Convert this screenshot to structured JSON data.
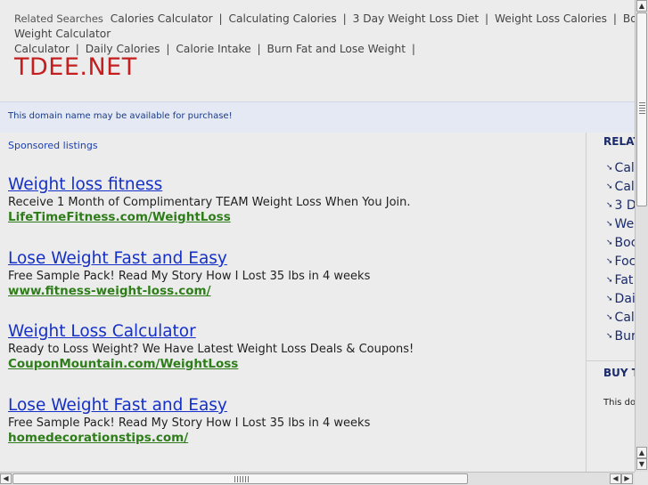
{
  "related_bar": {
    "label": "Related Searches",
    "links": [
      "Calories Calculator",
      "Calculating Calories",
      "3 Day Weight Loss Diet",
      "Weight Loss Calories",
      "Body Weight Calculator",
      "Calculator",
      "Daily Calories",
      "Calorie Intake",
      "Burn Fat and Lose Weight"
    ],
    "separator": "|"
  },
  "brand": {
    "name": "TDEE.NET",
    "color": "#c41e1e"
  },
  "notice": {
    "text": "This domain name may be available for purchase!"
  },
  "main": {
    "sponsored_label": "Sponsored listings",
    "ads": [
      {
        "title": "Weight loss fitness",
        "description": "Receive 1 Month of Complimentary TEAM Weight Loss When You Join.",
        "url": "LifeTimeFitness.com/WeightLoss"
      },
      {
        "title": "Lose Weight Fast and Easy",
        "description": "Free Sample Pack! Read My Story How I Lost 35 lbs in 4 weeks",
        "url": "www.fitness-weight-loss.com/"
      },
      {
        "title": "Weight Loss Calculator",
        "description": "Ready to Loss Weight? We Have Latest Weight Loss Deals & Coupons!",
        "url": "CouponMountain.com/WeightLoss"
      },
      {
        "title": "Lose Weight Fast and Easy",
        "description": "Free Sample Pack! Read My Story How I Lost 35 lbs in 4 weeks",
        "url": "homedecorationstips.com/"
      }
    ]
  },
  "sidebar": {
    "heading": "RELAT",
    "items": [
      "Cal",
      "Cal",
      "3 D",
      "We",
      "Boc",
      "Foc",
      "Fat",
      "Dai",
      "Cal",
      "Bur"
    ],
    "buy_heading": "BUY T",
    "buy_text": "This don"
  },
  "colors": {
    "ad_title": "#1530c8",
    "ad_url": "#2e7d1a",
    "sidebar_text": "#1a2a6a"
  },
  "icons": {
    "scroll_up": "▲",
    "scroll_down": "▼",
    "scroll_left": "◀",
    "scroll_right": "▶",
    "bullet": "➘"
  }
}
